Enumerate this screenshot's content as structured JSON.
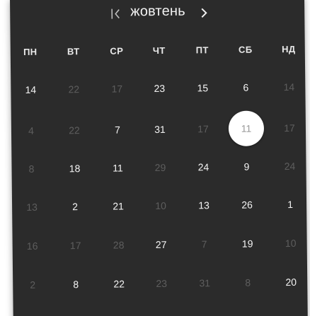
{
  "calendar": {
    "month_label": "жовтень",
    "prev_icon": "chevron-left-bar-icon",
    "next_icon": "chevron-right-icon",
    "weekdays": [
      "ПН",
      "ВТ",
      "СР",
      "ЧТ",
      "ПТ",
      "СБ",
      "НД"
    ],
    "weeks": [
      [
        {
          "t": "14",
          "m": false
        },
        {
          "t": "22",
          "m": true
        },
        {
          "t": "17",
          "m": true
        },
        {
          "t": "23",
          "m": false
        },
        {
          "t": "15",
          "m": false
        },
        {
          "t": "6",
          "m": false
        },
        {
          "t": "14",
          "m": true
        }
      ],
      [
        {
          "t": "4",
          "m": true
        },
        {
          "t": "22",
          "m": true
        },
        {
          "t": "7",
          "m": false
        },
        {
          "t": "31",
          "m": false
        },
        {
          "t": "17",
          "m": true
        },
        {
          "t": "11",
          "m": false,
          "selected": true
        },
        {
          "t": "17",
          "m": true
        }
      ],
      [
        {
          "t": "8",
          "m": true
        },
        {
          "t": "18",
          "m": false
        },
        {
          "t": "11",
          "m": false
        },
        {
          "t": "29",
          "m": true
        },
        {
          "t": "24",
          "m": false
        },
        {
          "t": "9",
          "m": false
        },
        {
          "t": "24",
          "m": true
        }
      ],
      [
        {
          "t": "13",
          "m": true
        },
        {
          "t": "2",
          "m": false
        },
        {
          "t": "21",
          "m": false
        },
        {
          "t": "10",
          "m": true
        },
        {
          "t": "13",
          "m": false
        },
        {
          "t": "26",
          "m": false
        },
        {
          "t": "1",
          "m": false
        }
      ],
      [
        {
          "t": "16",
          "m": true
        },
        {
          "t": "17",
          "m": true
        },
        {
          "t": "28",
          "m": true
        },
        {
          "t": "27",
          "m": false
        },
        {
          "t": "7",
          "m": true
        },
        {
          "t": "19",
          "m": false
        },
        {
          "t": "10",
          "m": true
        }
      ],
      [
        {
          "t": "2",
          "m": true
        },
        {
          "t": "8",
          "m": false
        },
        {
          "t": "22",
          "m": false
        },
        {
          "t": "23",
          "m": true
        },
        {
          "t": "31",
          "m": true
        },
        {
          "t": "8",
          "m": true
        },
        {
          "t": "20",
          "m": false
        }
      ]
    ]
  },
  "colors": {
    "panel_bg": "#2b2b2b",
    "text_primary": "#f4f4f4",
    "text_muted": "#5e5e5e",
    "selected_bg": "#ffffff",
    "selected_text": "#9a9a9a"
  }
}
